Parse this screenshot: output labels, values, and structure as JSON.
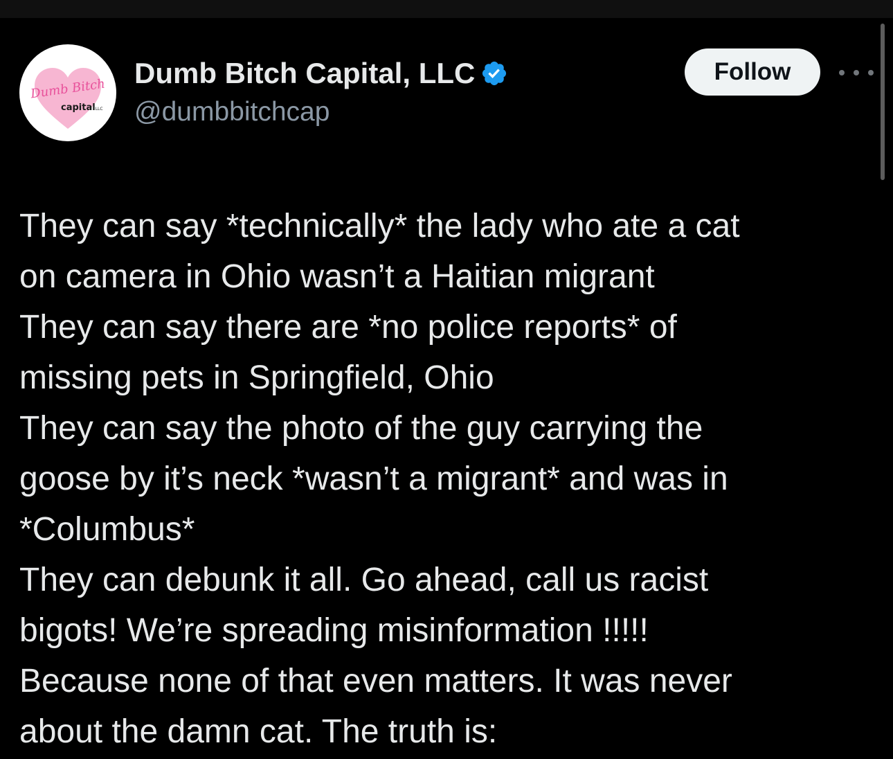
{
  "post": {
    "author": {
      "display_name": "Dumb Bitch Capital, LLC",
      "handle": "@dumbbitchcap",
      "verified": true,
      "avatar": {
        "script_text": "Dumb Bitch",
        "sub_text": "capital",
        "sub_text_small": "LLC"
      }
    },
    "follow_label": "Follow",
    "more_icon": "ellipsis-icon",
    "verified_icon": "verified-badge-icon",
    "text_lines": [
      "They can say *technically* the lady who ate a cat",
      "on camera in Ohio wasn’t a Haitian migrant",
      "They can say there are *no police reports* of",
      "missing pets in Springfield, Ohio",
      "They can say the photo of the guy carrying the",
      "goose by it’s neck *wasn’t a migrant* and was in",
      "*Columbus*",
      "They can debunk it all. Go ahead, call us racist",
      "bigots! We’re spreading misinformation !!!!!",
      "Because none of that even matters. It was never",
      "about the damn cat. The truth is:"
    ]
  },
  "colors": {
    "background": "#000000",
    "text_primary": "#e7e9ea",
    "text_secondary": "#8b98a5",
    "verified_blue": "#1d9bf0",
    "follow_bg": "#eff3f4",
    "avatar_heart": "#f7b6d2",
    "avatar_script": "#e8509a"
  }
}
